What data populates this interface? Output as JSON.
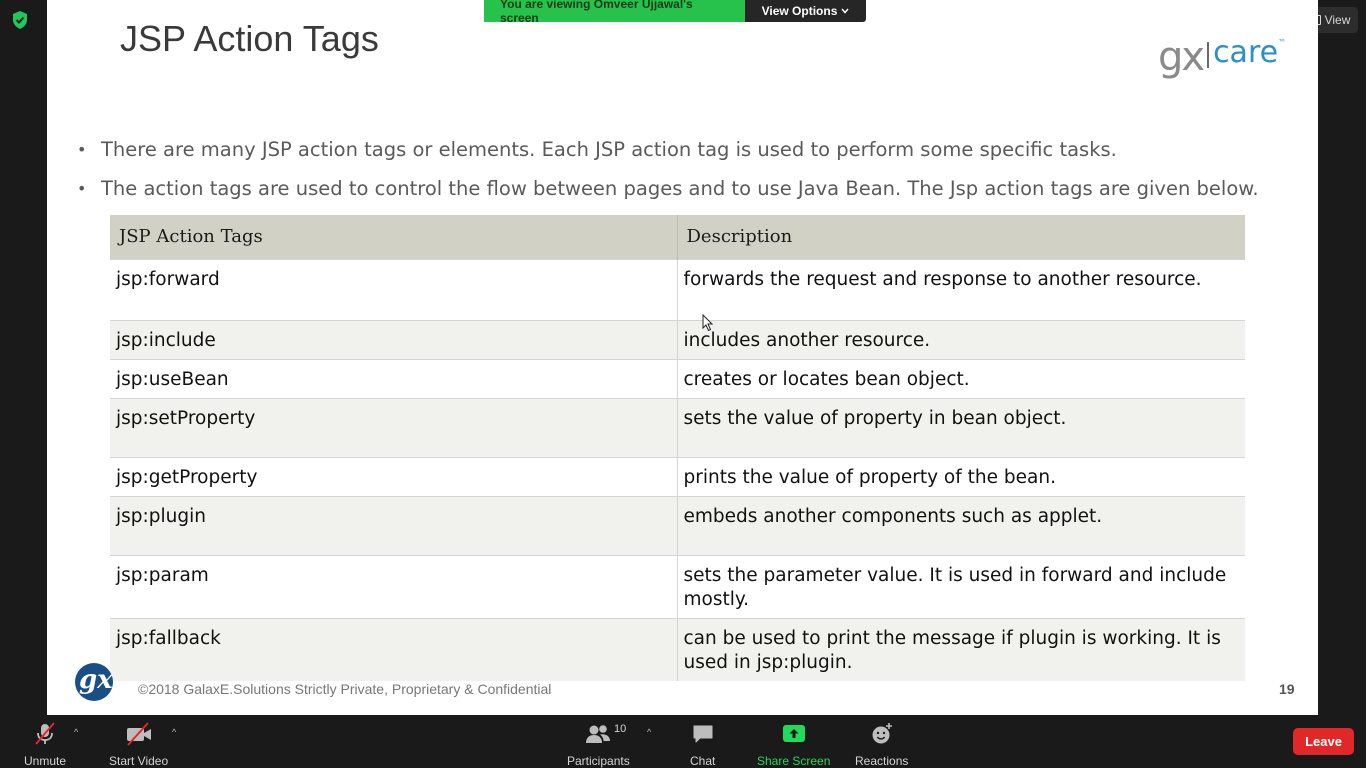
{
  "banner": {
    "viewing_text": "You are viewing Omveer Ujjawal's screen",
    "view_options_label": "View Options"
  },
  "top_right": {
    "view_label": "View"
  },
  "slide": {
    "title": "JSP Action Tags",
    "logo": {
      "gx": "gx",
      "care": "care",
      "tm": "™"
    },
    "bullets": [
      "There are many JSP action tags or elements. Each JSP action tag is used to perform some specific tasks.",
      "The action tags are used to control the flow between pages and to use Java Bean. The Jsp action tags are given below."
    ],
    "table": {
      "headers": [
        "JSP Action Tags",
        "Description"
      ],
      "rows": [
        {
          "tag": "jsp:forward",
          "desc": "forwards the request and response to another resource."
        },
        {
          "tag": "jsp:include",
          "desc": "includes another resource."
        },
        {
          "tag": "jsp:useBean",
          "desc": "creates or locates bean object."
        },
        {
          "tag": "jsp:setProperty",
          "desc": "sets the value of property in bean object."
        },
        {
          "tag": "jsp:getProperty",
          "desc": "prints the value of property of the bean."
        },
        {
          "tag": "jsp:plugin",
          "desc": "embeds another components such as applet."
        },
        {
          "tag": "jsp:param",
          "desc": "sets the parameter value. It is used in forward and include mostly."
        },
        {
          "tag": "jsp:fallback",
          "desc": "can be used to print the message if plugin is working. It is used in jsp:plugin."
        }
      ]
    },
    "footer_logo_text": "gx",
    "footer_text": "©2018 GalaxE.Solutions Strictly Private, Proprietary & Confidential",
    "page_number": "19"
  },
  "controls": {
    "unmute_label": "Unmute",
    "start_video_label": "Start Video",
    "participants_label": "Participants",
    "participants_count": "10",
    "chat_label": "Chat",
    "share_screen_label": "Share Screen",
    "reactions_label": "Reactions",
    "leave_label": "Leave"
  },
  "colors": {
    "banner_green": "#27c24c",
    "share_green": "#23d959",
    "leave_red": "#e02828",
    "table_header": "#d1d2c5",
    "logo_blue": "#2b8fc9"
  }
}
